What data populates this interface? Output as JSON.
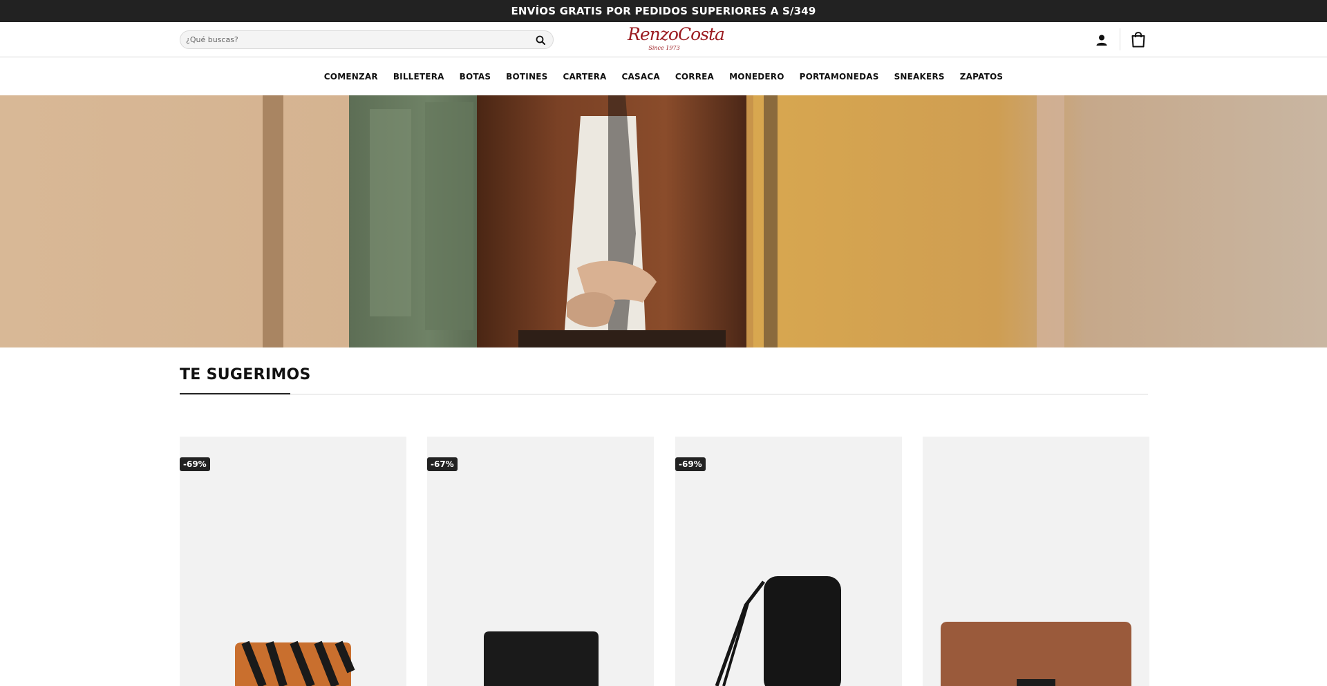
{
  "announcement": "ENVÍOS GRATIS POR PEDIDOS SUPERIORES A S/349",
  "search": {
    "placeholder": "¿Qué buscas?"
  },
  "logo": {
    "brand": "RenzoCosta",
    "since": "Since 1973"
  },
  "nav": [
    "COMENZAR",
    "BILLETERA",
    "BOTAS",
    "BOTINES",
    "CARTERA",
    "CASACA",
    "CORREA",
    "MONEDERO",
    "PORTAMONEDAS",
    "SNEAKERS",
    "ZAPATOS"
  ],
  "section": {
    "title": "TE SUGERIMOS"
  },
  "products": [
    {
      "badge": "-69%",
      "item": "zebra-wallet"
    },
    {
      "badge": "-67%",
      "item": "black-billfold"
    },
    {
      "badge": "-69%",
      "item": "black-zip-wallet"
    },
    {
      "badge": "",
      "item": "brown-wallet"
    }
  ],
  "colors": {
    "topbar": "#222222",
    "brand": "#9b1b20",
    "card_bg": "#f2f2f2",
    "badge": "#222222"
  },
  "icons": [
    "search-icon",
    "user-icon",
    "shopping-bag-icon"
  ]
}
